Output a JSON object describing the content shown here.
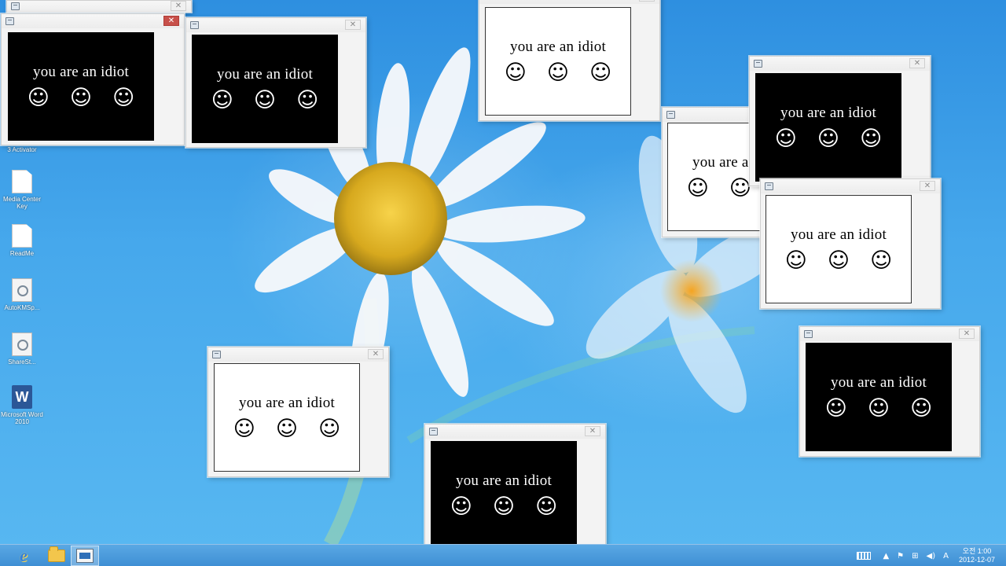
{
  "popup": {
    "message": "you are an idiot",
    "face": "☺",
    "close_glyph": "✕"
  },
  "desktop_icons": [
    {
      "label": "3 Activator"
    },
    {
      "label": "Media Center Key"
    },
    {
      "label": "ReadMe"
    },
    {
      "label": "AutoKMSp..."
    },
    {
      "label": "ShareSt..."
    },
    {
      "label": "Microsoft Word 2010"
    }
  ],
  "word_letter": "W",
  "taskbar": {
    "ie_letter": "e",
    "tray": {
      "flag": "⚑",
      "network": "⊞",
      "volume": "◀)",
      "ime": "A",
      "chevron": "▲",
      "time": "오전 1:00",
      "date": "2012-12-07"
    }
  },
  "colors": {
    "desktop_blue": "#3a9ce6",
    "popup_black": "#000000",
    "popup_white": "#ffffff",
    "close_active": "#c7504a"
  }
}
